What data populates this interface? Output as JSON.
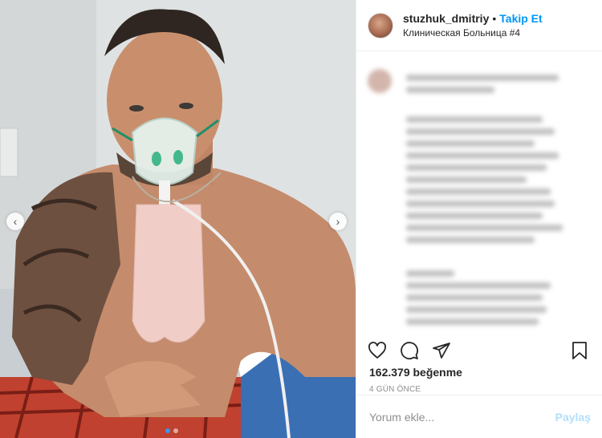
{
  "header": {
    "username": "stuzhuk_dmitriy",
    "separator": "•",
    "follow_label": "Takip Et",
    "location": "Клиническая Больница #4"
  },
  "media": {
    "slide_count": 2,
    "active_slide": 1,
    "prev_icon": "‹",
    "next_icon": "›"
  },
  "actions": {
    "icons": [
      "heart-icon",
      "comment-icon",
      "share-icon",
      "bookmark-icon"
    ]
  },
  "likes": {
    "text": "162.379 beğenme"
  },
  "time": {
    "text": "4 GÜN ÖNCE"
  },
  "comment": {
    "placeholder": "Yorum ekle...",
    "post_label": "Paylaş"
  },
  "colors": {
    "follow": "#0095f6",
    "post_disabled": "#b2dffc",
    "active_dot": "#3897f0"
  }
}
